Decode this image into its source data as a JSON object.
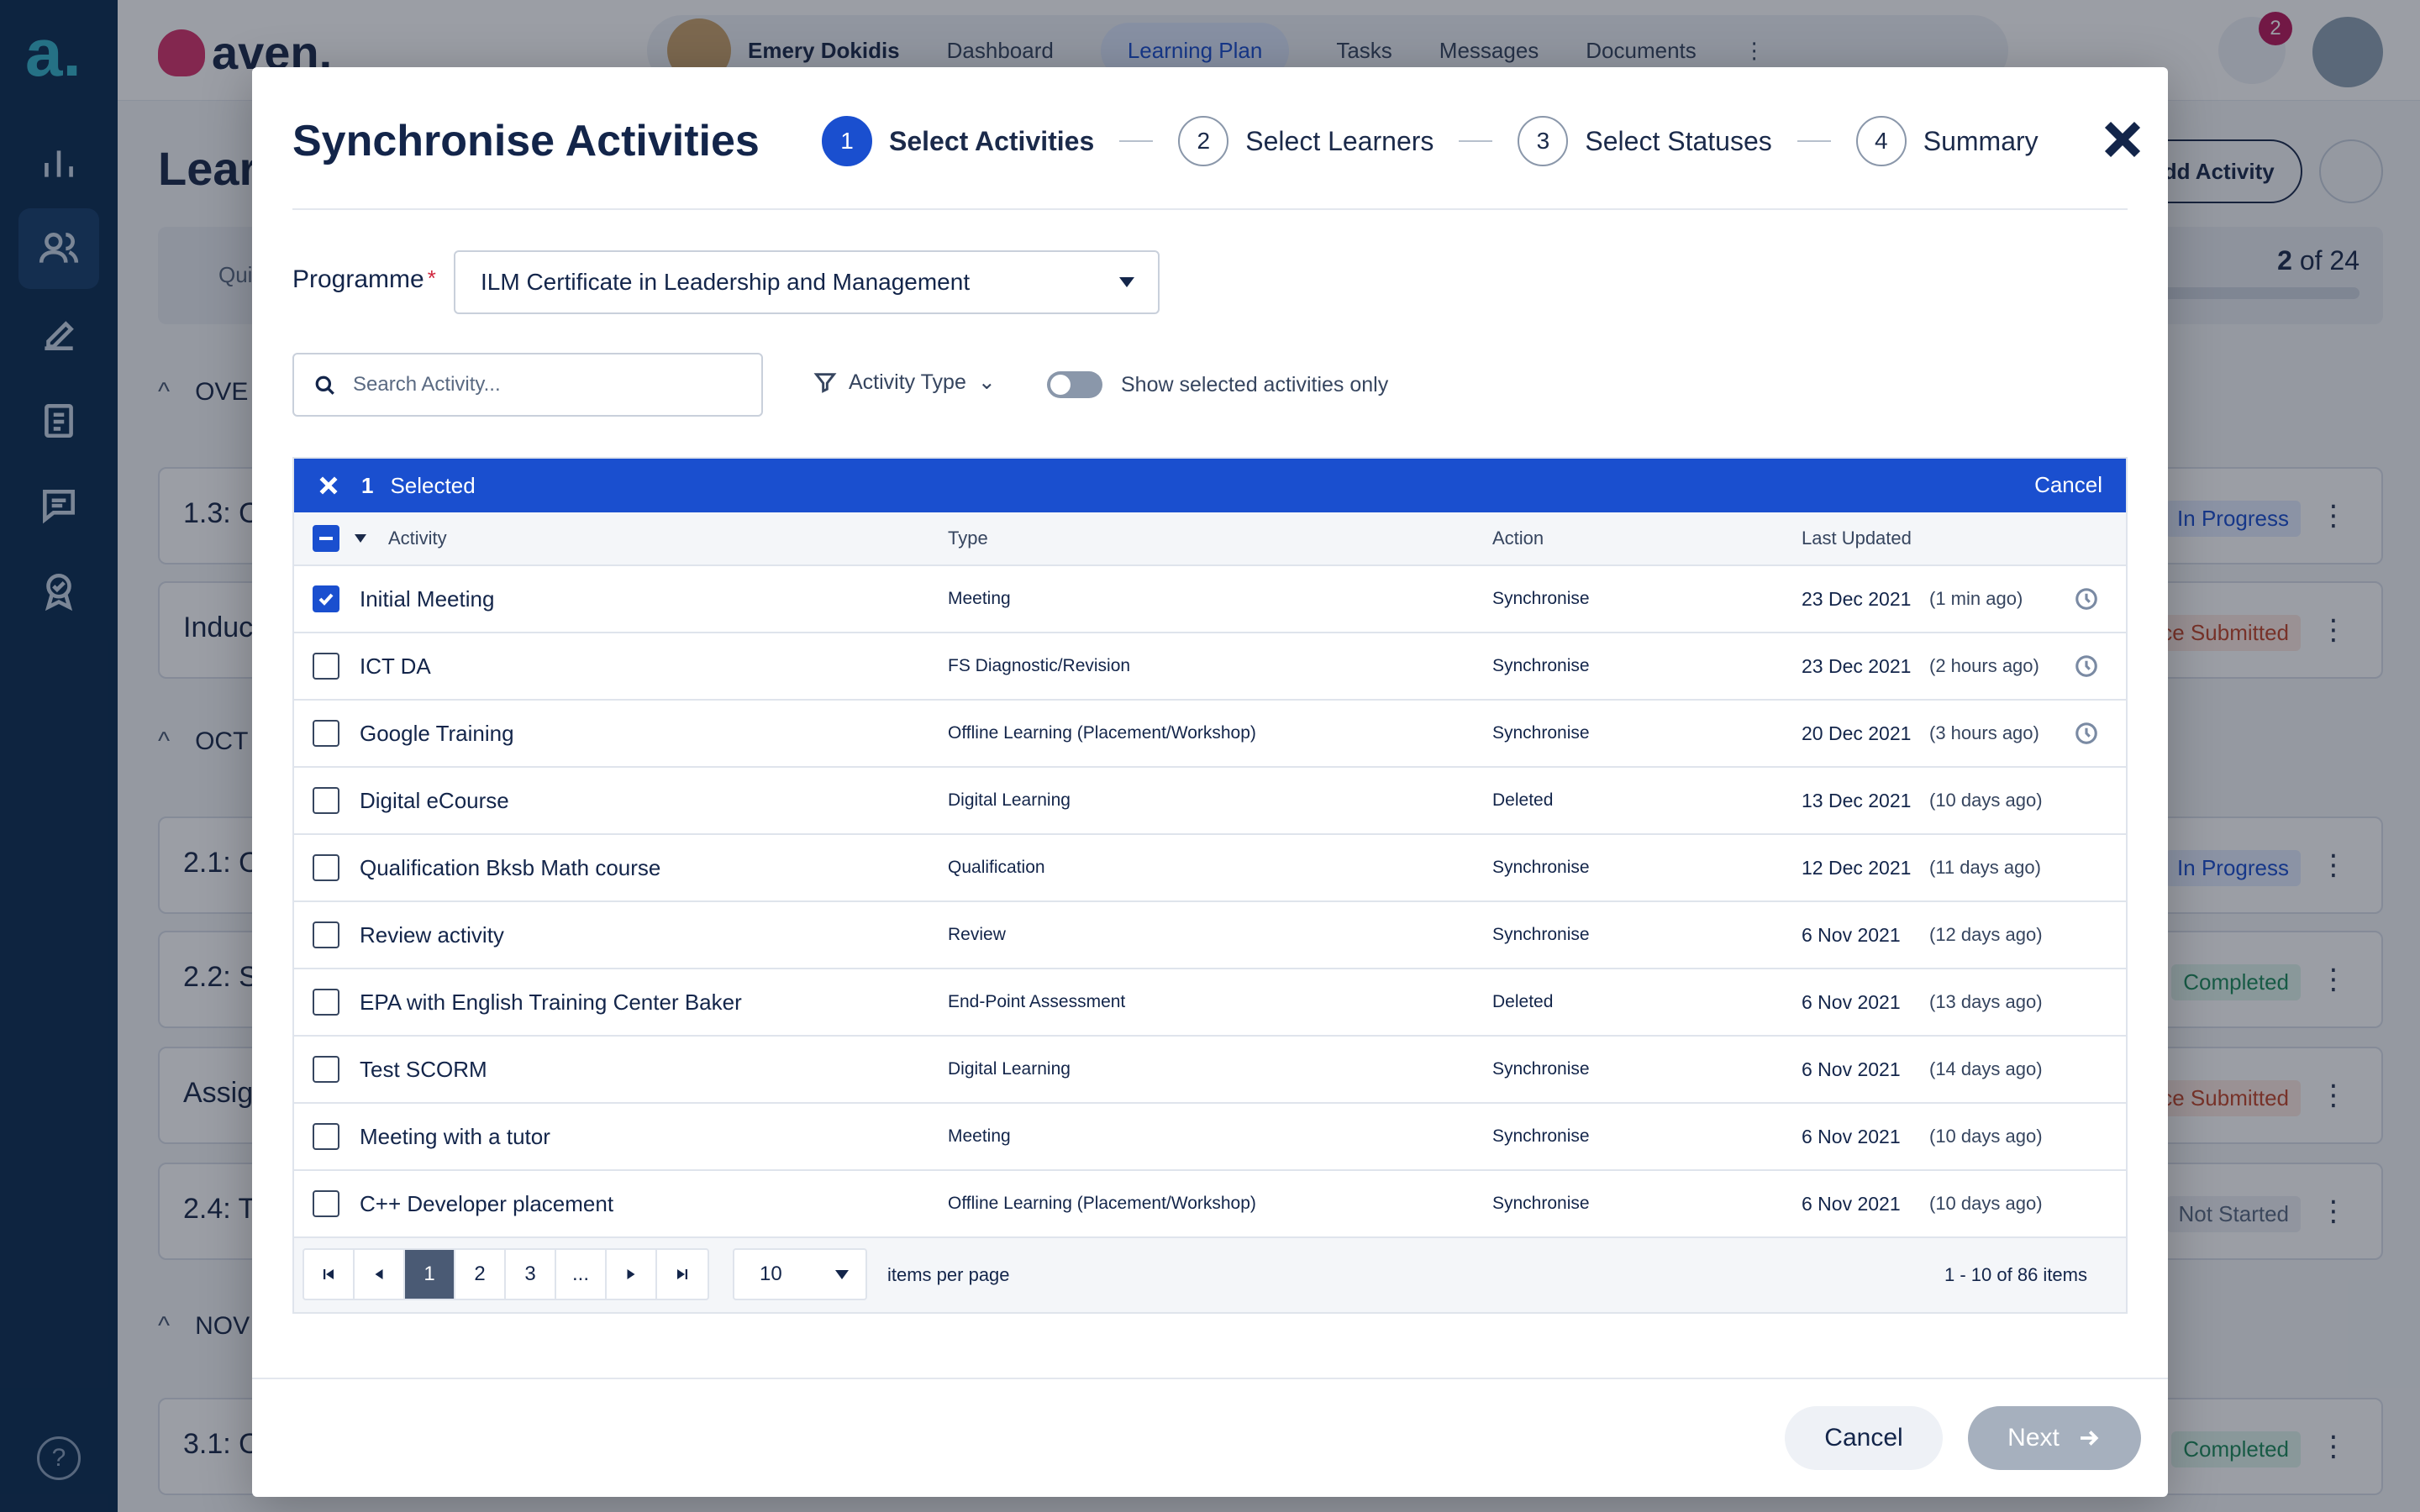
{
  "app": {
    "brand": "aven.",
    "user_name": "Emery Dokidis",
    "nav": [
      "Dashboard",
      "Learning Plan",
      "Tasks",
      "Messages",
      "Documents"
    ],
    "notifications": "2",
    "page_title": "Learn",
    "add_activity": "Add Activity",
    "filter_quick": "Qui",
    "progress_count": "2",
    "progress_of": "of 24",
    "sections": [
      "OVE",
      "OCT",
      "NOV"
    ],
    "cards": [
      {
        "title": "1.3: O",
        "status": "In Progress"
      },
      {
        "title": "Induc",
        "status": "ce Submitted"
      },
      {
        "title": "2.1: O",
        "status": "In Progress"
      },
      {
        "title": "2.2: S",
        "status": "Completed"
      },
      {
        "title": "Assig",
        "status": "ce Submitted"
      },
      {
        "title": "2.4: T",
        "status": "Not Started"
      },
      {
        "title": "3.1: O",
        "status": "Completed"
      }
    ],
    "help": "?"
  },
  "modal": {
    "title": "Synchronise Activities",
    "steps": [
      {
        "num": "1",
        "label": "Select Activities"
      },
      {
        "num": "2",
        "label": "Select Learners"
      },
      {
        "num": "3",
        "label": "Select Statuses"
      },
      {
        "num": "4",
        "label": "Summary"
      }
    ],
    "programme_label": "Programme",
    "programme_required": "*",
    "programme_value": "ILM Certificate in Leadership and Management",
    "search_placeholder": "Search Activity...",
    "filter_type": "Activity Type",
    "toggle_label": "Show selected activities only",
    "selection": {
      "count": "1",
      "text": "Selected",
      "cancel": "Cancel"
    },
    "columns": {
      "activity": "Activity",
      "type": "Type",
      "action": "Action",
      "last_updated": "Last Updated"
    },
    "rows": [
      {
        "activity": "Initial Meeting",
        "type": "Meeting",
        "action": "Synchronise",
        "date": "23 Dec 2021",
        "ago": "(1 min ago)"
      },
      {
        "activity": "ICT DA",
        "type": "FS Diagnostic/Revision",
        "action": "Synchronise",
        "date": "23 Dec 2021",
        "ago": "(2 hours ago)"
      },
      {
        "activity": "Google Training",
        "type": "Offline Learning (Placement/Workshop)",
        "action": "Synchronise",
        "date": "20 Dec 2021",
        "ago": "(3 hours ago)"
      },
      {
        "activity": "Digital eCourse",
        "type": "Digital Learning",
        "action": "Deleted",
        "date": "13 Dec 2021",
        "ago": "(10 days ago)"
      },
      {
        "activity": "Qualification Bksb Math course",
        "type": "Qualification",
        "action": "Synchronise",
        "date": "12 Dec 2021",
        "ago": "(11 days ago)"
      },
      {
        "activity": "Review activity",
        "type": "Review",
        "action": "Synchronise",
        "date": "6 Nov 2021",
        "ago": "(12 days ago)"
      },
      {
        "activity": "EPA with English Training Center  Baker",
        "type": "End-Point Assessment",
        "action": "Deleted",
        "date": "6 Nov 2021",
        "ago": "(13 days ago)"
      },
      {
        "activity": "Test SCORM",
        "type": "Digital Learning",
        "action": "Synchronise",
        "date": "6 Nov 2021",
        "ago": "(14 days ago)"
      },
      {
        "activity": "Meeting with a tutor",
        "type": "Meeting",
        "action": "Synchronise",
        "date": "6 Nov 2021",
        "ago": "(10 days ago)"
      },
      {
        "activity": "C++ Developer placement",
        "type": "Offline Learning (Placement/Workshop)",
        "action": "Synchronise",
        "date": "6 Nov 2021",
        "ago": "(10 days ago)"
      }
    ],
    "pager": {
      "pages": [
        "1",
        "2",
        "3",
        "..."
      ],
      "per_page": "10",
      "per_page_label": "items per page",
      "info": "1 - 10 of 86 items"
    },
    "cancel": "Cancel",
    "next": "Next"
  }
}
